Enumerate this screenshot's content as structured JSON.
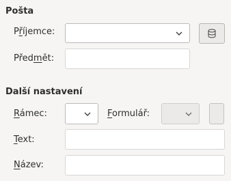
{
  "mail": {
    "section_title": "Pošta",
    "recipient": {
      "label_prefix": "P",
      "label_underlined": "ř",
      "label_suffix": "íjemce:",
      "value": ""
    },
    "address_book_button": {
      "icon": "database-icon"
    },
    "subject": {
      "label_prefix": "Před",
      "label_underlined": "m",
      "label_suffix": "ět:",
      "value": ""
    }
  },
  "other": {
    "section_title": "Další nastavení",
    "frame": {
      "label_prefix": "",
      "label_underlined": "R",
      "label_suffix": "ámec:",
      "value": ""
    },
    "form": {
      "label_prefix": "",
      "label_underlined": "F",
      "label_suffix": "ormulář:",
      "value": ""
    },
    "text": {
      "label_prefix": "",
      "label_underlined": "T",
      "label_suffix": "ext:",
      "value": ""
    },
    "name": {
      "label_prefix": "",
      "label_underlined": "N",
      "label_suffix": "ázev:",
      "value": ""
    }
  }
}
